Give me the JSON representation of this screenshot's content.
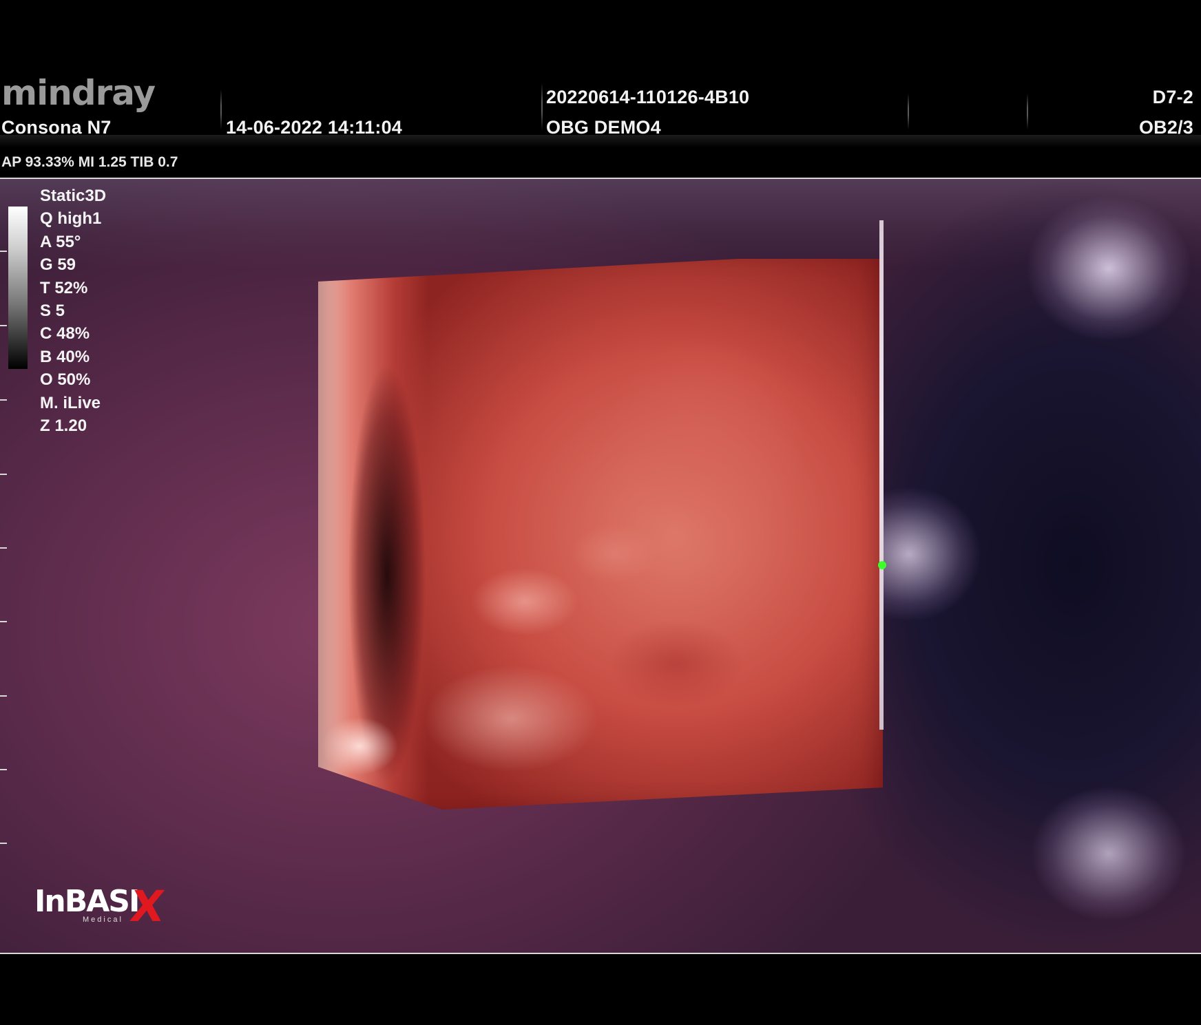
{
  "header": {
    "brand_logo": "mindray",
    "model": "Consona N7",
    "datetime": "14-06-2022  14:11:04",
    "exam_id": "20220614-110126-4B10",
    "patient": "OBG DEMO4",
    "probe": "D7-2",
    "preset": "OB2/3"
  },
  "acoustic": {
    "output_line": "AP 93.33%  MI 1.25 TIB 0.7"
  },
  "params": [
    "Static3D",
    "Q high1",
    "A 55°",
    "G 59",
    "T 52%",
    "S 5",
    "C 48%",
    "B 40%",
    "O 50%",
    "M. iLive",
    "Z 1.20"
  ],
  "watermark": {
    "main": "InBASI",
    "x": "X",
    "sub": "Medical"
  },
  "colors": {
    "background": "#000000",
    "render_tint": "#c84c42",
    "marker": "#3cff2a",
    "brand_red": "#e01820"
  }
}
